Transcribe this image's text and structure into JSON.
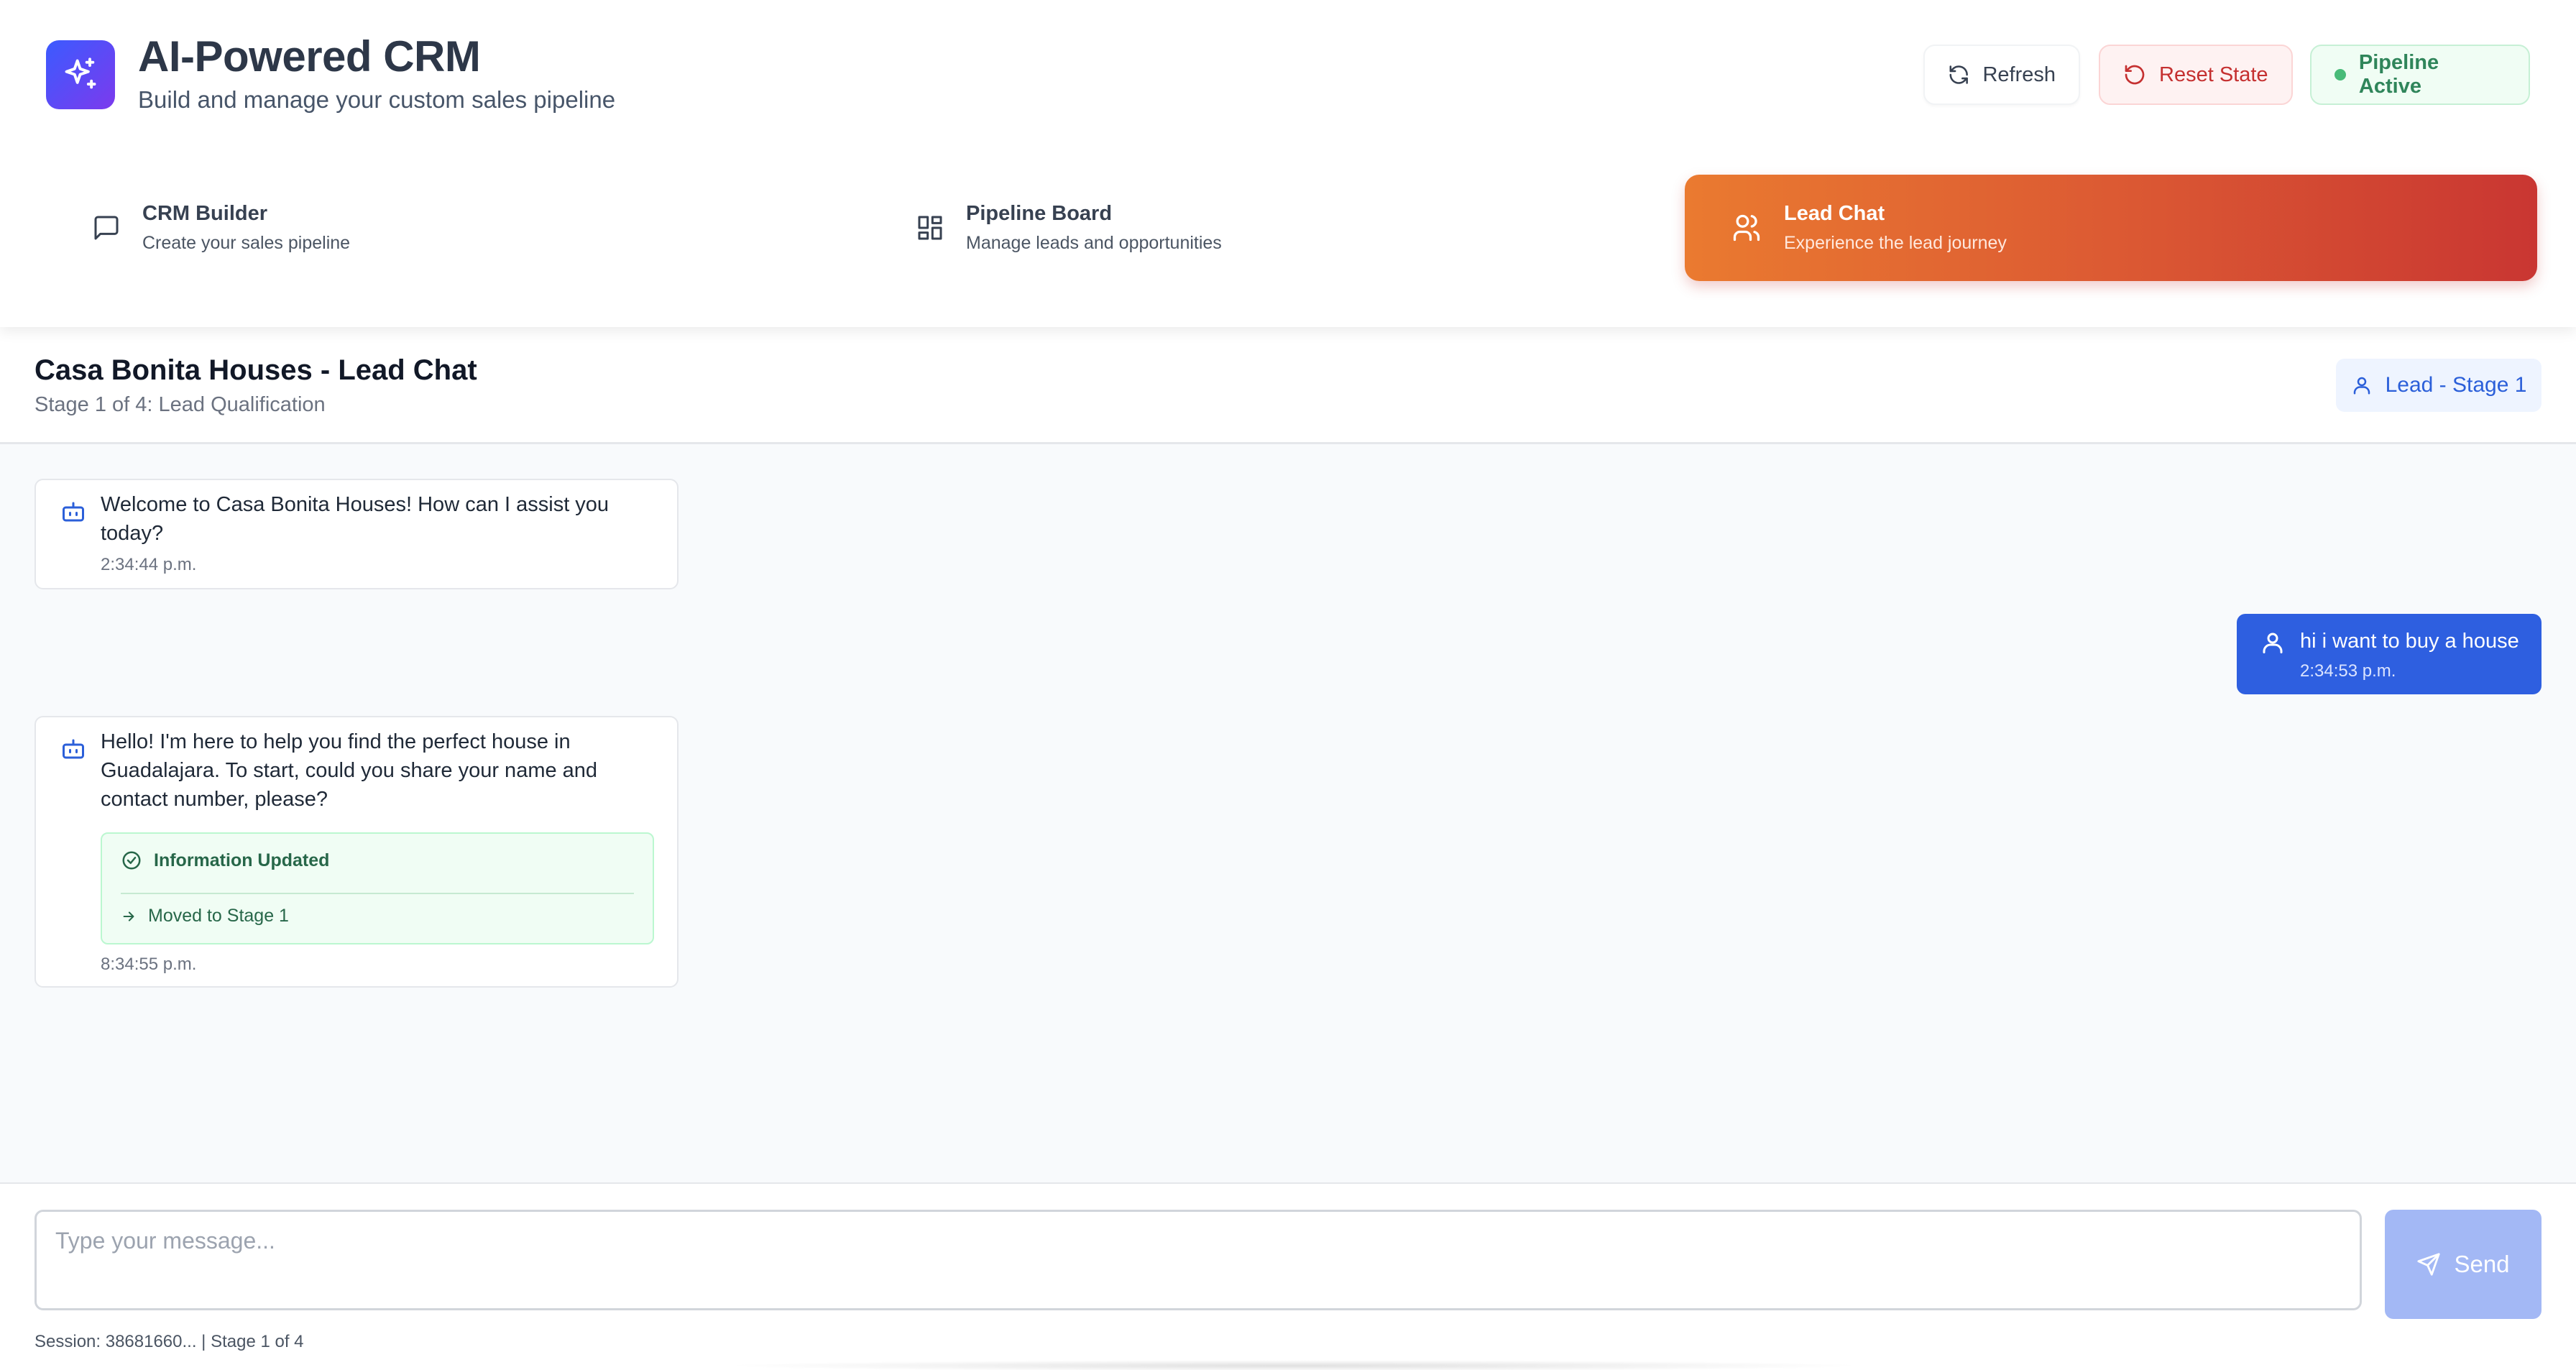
{
  "header": {
    "title": "AI-Powered CRM",
    "subtitle": "Build and manage your custom sales pipeline",
    "logo_icon": "sparkles-icon",
    "buttons": {
      "refresh": "Refresh",
      "reset": "Reset State",
      "status": "Pipeline Active"
    }
  },
  "tabs": [
    {
      "title": "CRM Builder",
      "desc": "Create your sales pipeline",
      "icon": "message-square-icon",
      "active": false
    },
    {
      "title": "Pipeline Board",
      "desc": "Manage leads and opportunities",
      "icon": "layout-grid-icon",
      "active": false
    },
    {
      "title": "Lead Chat",
      "desc": "Experience the lead journey",
      "icon": "users-icon",
      "active": true
    }
  ],
  "chat": {
    "title": "Casa Bonita Houses - Lead Chat",
    "subtitle": "Stage 1 of 4: Lead Qualification",
    "badge": "Lead - Stage 1"
  },
  "messages": [
    {
      "from": "bot",
      "text": "Welcome to Casa Bonita Houses! How can I assist you today?",
      "time": "2:34:44 p.m."
    },
    {
      "from": "user",
      "text": "hi i want to buy a house",
      "time": "2:34:53 p.m."
    },
    {
      "from": "bot",
      "text": "Hello! I'm here to help you find the perfect house in Guadalajara. To start, could you share your name and contact number, please?",
      "time": "8:34:55 p.m.",
      "info": {
        "updated": "Information Updated",
        "moved": "Moved to Stage 1"
      }
    }
  ],
  "input": {
    "placeholder": "Type your message...",
    "send_label": "Send"
  },
  "footer": {
    "session": "Session: 38681660... | Stage 1 of 4"
  },
  "colors": {
    "accent_blue": "#2e5fe0",
    "tab_active_start": "#ea7a30",
    "tab_active_end": "#c93632",
    "success_green": "#2f855a",
    "danger_red": "#c53030"
  }
}
